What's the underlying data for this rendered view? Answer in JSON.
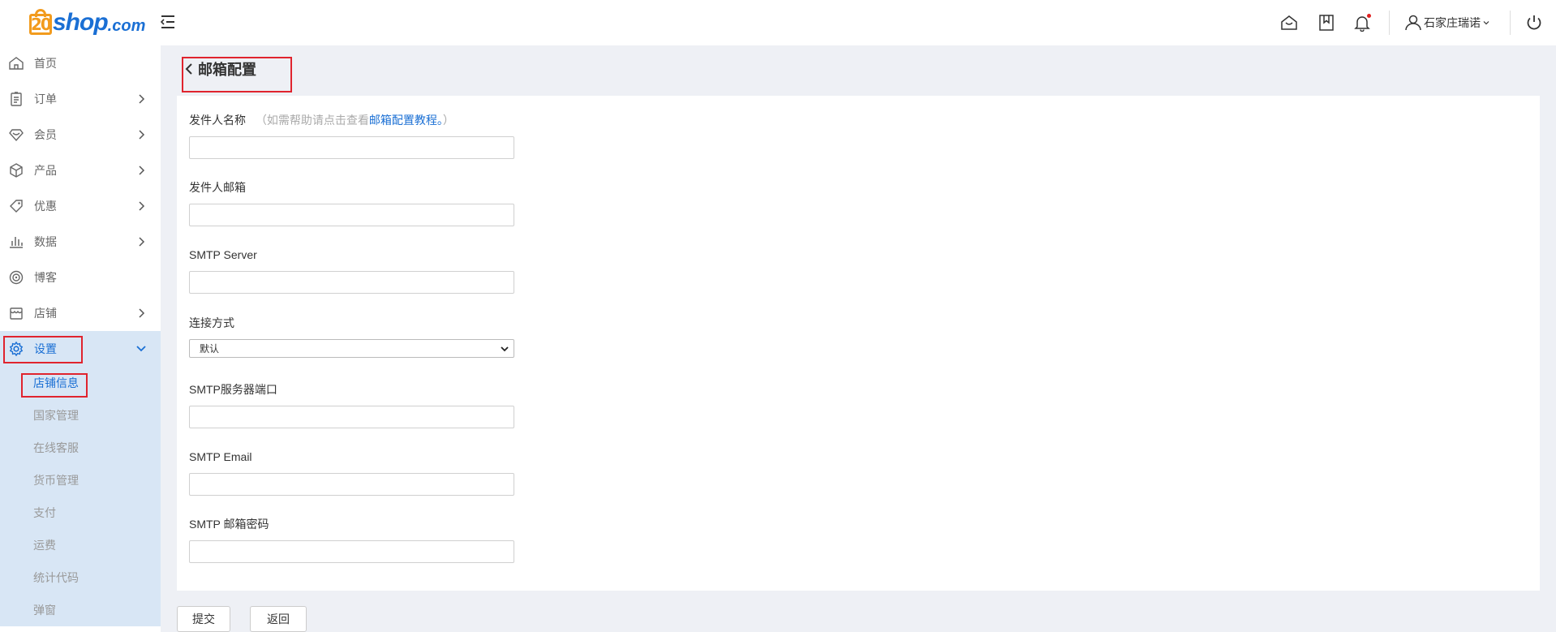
{
  "header": {
    "logo_number": "20",
    "logo_text": "shop",
    "logo_suffix": ".com",
    "user_name": "石家庄瑞诺"
  },
  "sidebar": {
    "items": [
      {
        "label": "首页",
        "icon": "home-icon"
      },
      {
        "label": "订单",
        "icon": "order-icon"
      },
      {
        "label": "会员",
        "icon": "member-icon"
      },
      {
        "label": "产品",
        "icon": "product-icon"
      },
      {
        "label": "优惠",
        "icon": "tag-icon"
      },
      {
        "label": "数据",
        "icon": "chart-icon"
      },
      {
        "label": "博客",
        "icon": "blog-icon"
      },
      {
        "label": "店铺",
        "icon": "store-icon"
      },
      {
        "label": "设置",
        "icon": "gear-icon"
      }
    ],
    "submenu": [
      "店铺信息",
      "国家管理",
      "在线客服",
      "货币管理",
      "支付",
      "运费",
      "统计代码",
      "弹窗"
    ]
  },
  "page": {
    "title": "邮箱配置"
  },
  "form": {
    "sender_name_label": "发件人名称",
    "help_prefix": "（如需帮助请点击查看",
    "help_link": "邮箱配置教程。",
    "help_suffix": "）",
    "sender_email_label": "发件人邮箱",
    "smtp_server_label": "SMTP Server",
    "connection_label": "连接方式",
    "connection_value": "默认",
    "smtp_port_label": "SMTP服务器端口",
    "smtp_email_label": "SMTP Email",
    "smtp_password_label": "SMTP 邮箱密码"
  },
  "buttons": {
    "submit": "提交",
    "back": "返回"
  },
  "colors": {
    "accent": "#1a6fd4",
    "logo_orange": "#f29b1d",
    "highlight_box": "#e0242e",
    "active_bg": "#d8e6f5"
  }
}
